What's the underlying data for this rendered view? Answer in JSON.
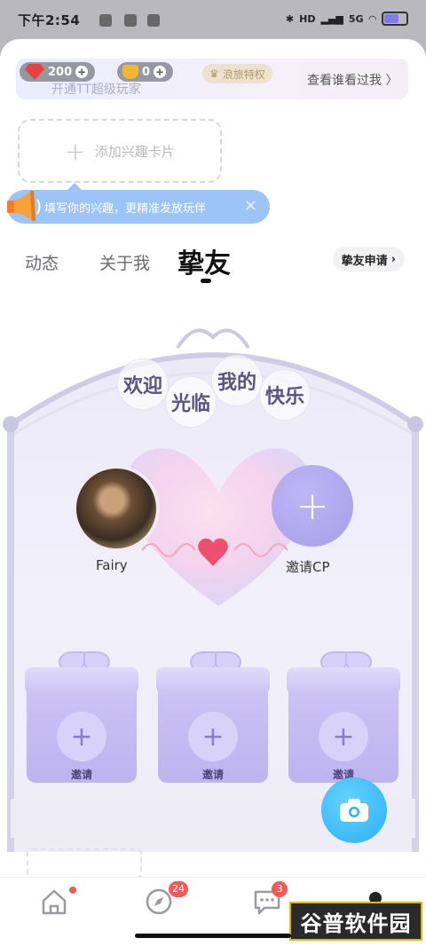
{
  "status_bar": {
    "time": "下午2:54",
    "signal_label": "HD",
    "network_type": "5G"
  },
  "vip_bar": {
    "gems": "200",
    "coins": "0",
    "privilege_label": "浪旅特权",
    "promo_text": "开通TT超级玩家",
    "visitors_link": "查看谁看过我 〉"
  },
  "interest_card": {
    "add_label": "添加兴趣卡片"
  },
  "tip": {
    "text": "填写你的兴趣，更精准发放玩伴",
    "close": "✕"
  },
  "tabs": {
    "items": [
      {
        "label": "动态"
      },
      {
        "label": "关于我"
      },
      {
        "label": "挚友"
      }
    ],
    "active": "挚友"
  },
  "friend_apply": {
    "label": "挚友申请",
    "chevron": "›"
  },
  "banner": {
    "chars": [
      "欢迎",
      "光临",
      "我的",
      "快乐"
    ]
  },
  "cp": {
    "user_name": "Fairy",
    "invite_label": "邀请CP",
    "invite_plus": "+"
  },
  "gift_slots": [
    {
      "label": "邀请",
      "plus": "+"
    },
    {
      "label": "邀请",
      "plus": "+"
    },
    {
      "label": "邀请",
      "plus": "+"
    }
  ],
  "nav": {
    "discover_badge": "24",
    "messages_badge": "3"
  },
  "watermark": "谷普软件园",
  "colors": {
    "accent": "#a69ee9",
    "badge": "#f25a5a",
    "camera": "#2fb0f6"
  }
}
